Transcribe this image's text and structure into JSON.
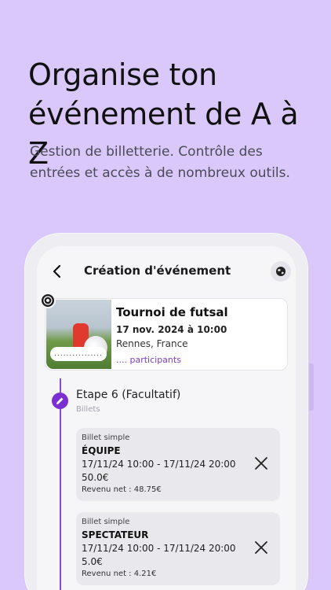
{
  "promo": {
    "headline_line1": "Organise ton",
    "headline_line2": "événement de A à Z",
    "subtitle_line1": "Gestion de billetterie. Contrôle des",
    "subtitle_line2": "entrées et accès à de nombreux outils."
  },
  "header": {
    "title": "Création d'événement",
    "back_icon": "chevron-left-icon",
    "globe_icon": "globe-icon"
  },
  "event": {
    "name": "Tournoi de futsal",
    "date": "17 nov. 2024 à 10:00",
    "location": "Rennes, France",
    "participants": ".... participants",
    "image_caption": "................"
  },
  "step": {
    "title": "Etape 6 (Facultatif)",
    "subtitle": "Billets",
    "icon": "pencil-icon"
  },
  "tickets": [
    {
      "type": "Billet simple",
      "name": "ÉQUIPE",
      "dates": "17/11/24 10:00 - 17/11/24 20:00",
      "price": "50.0€",
      "net": "Revenu net : 48.75€"
    },
    {
      "type": "Billet simple",
      "name": "SPECTATEUR",
      "dates": "17/11/24 10:00 - 17/11/24 20:00",
      "price": "5.0€",
      "net": "Revenu net : 4.21€"
    }
  ],
  "colors": {
    "background": "#d9c8f9",
    "accent": "#7b2fd0",
    "participants": "#7b3fc4"
  }
}
